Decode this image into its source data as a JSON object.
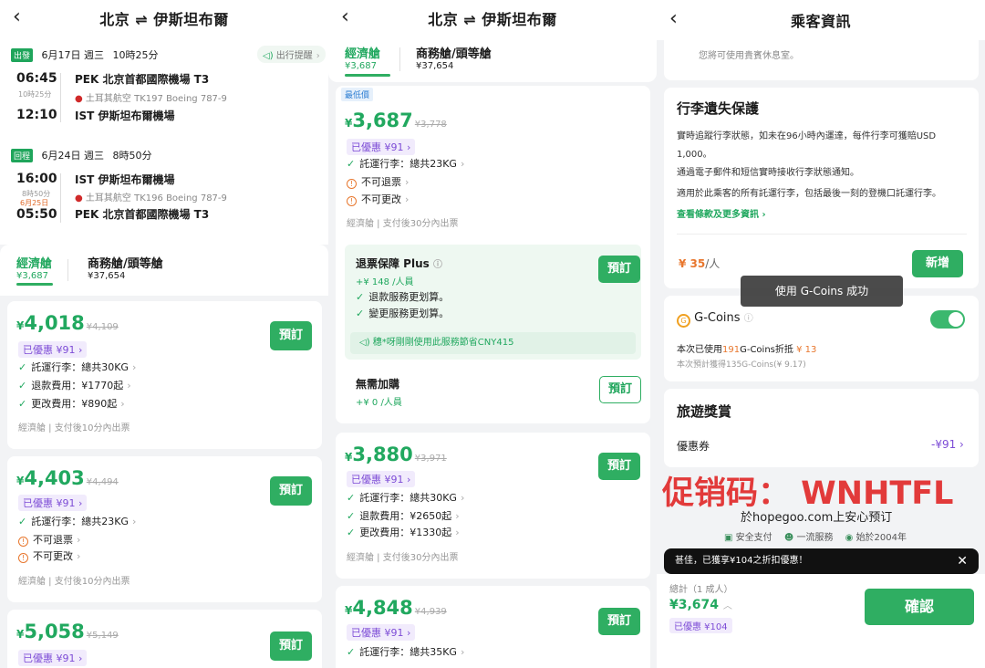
{
  "screen1": {
    "title_from": "北京",
    "title_swap": "⇌",
    "title_to": "伊斯坦布爾",
    "remind": "出行提醒",
    "outbound": {
      "tag": "出發",
      "date": "6月17日 週三",
      "duration": "10時25分",
      "dep_time": "06:45",
      "flight_dur": "10時25分",
      "arr_time": "12:10",
      "dep_airport": "PEK 北京首都國際機場 T3",
      "airline": "土耳其航空",
      "flight_no": "TK197",
      "aircraft": "Boeing 787-9",
      "arr_airport": "IST 伊斯坦布爾機場"
    },
    "inbound": {
      "tag": "回程",
      "date": "6月24日 週三",
      "duration": "8時50分",
      "dep_time": "16:00",
      "flight_dur": "8時50分",
      "next_day": "6月25日",
      "arr_time": "05:50",
      "dep_airport": "IST 伊斯坦布爾機場",
      "airline": "土耳其航空",
      "flight_no": "TK196",
      "aircraft": "Boeing 787-9",
      "arr_airport": "PEK 北京首都國際機場 T3"
    },
    "tabs": [
      {
        "label": "經濟艙",
        "price": "¥3,687"
      },
      {
        "label": "商務艙/頭等艙",
        "price": "¥37,654"
      }
    ],
    "fares": [
      {
        "yen": "¥",
        "price": "4,018",
        "orig": "¥4,109",
        "discount": "已優惠 ¥91 ›",
        "f1": "託運行李：總共30KG",
        "f2": "退款費用：¥1770起",
        "f3": "更改費用：¥890起",
        "note": "經濟艙 | 支付後10分內出票",
        "btn": "預訂"
      },
      {
        "yen": "¥",
        "price": "4,403",
        "orig": "¥4,494",
        "discount": "已優惠 ¥91 ›",
        "f1": "託運行李：總共23KG",
        "f2": "不可退票",
        "f3": "不可更改",
        "note": "經濟艙 | 支付後10分內出票",
        "btn": "預訂"
      },
      {
        "yen": "¥",
        "price": "5,058",
        "orig": "¥5,149",
        "discount": "已優惠 ¥91 ›",
        "btn": "預訂"
      }
    ]
  },
  "screen2": {
    "title_from": "北京",
    "title_swap": "⇌",
    "title_to": "伊斯坦布爾",
    "tabs": [
      {
        "label": "經濟艙",
        "price": "¥3,687"
      },
      {
        "label": "商務艙/頭等艙",
        "price": "¥37,654"
      }
    ],
    "lowest": "最低價",
    "fare1": {
      "yen": "¥",
      "price": "3,687",
      "orig": "¥3,778",
      "discount": "已優惠 ¥91 ›",
      "f1": "託運行李：總共23KG",
      "f2": "不可退票",
      "f3": "不可更改",
      "note": "經濟艙 | 支付後30分內出票"
    },
    "plus": {
      "title": "退票保障 Plus",
      "price": "+¥ 148 /人員",
      "b1": "退款服務更划算。",
      "b2": "變更服務更划算。",
      "btn": "預訂",
      "tip": "穗*呀剛剛使用此服務節省CNY415"
    },
    "noadd": {
      "title": "無需加購",
      "price": "+¥ 0 /人員",
      "btn": "預訂"
    },
    "fare2": {
      "yen": "¥",
      "price": "3,880",
      "orig": "¥3,971",
      "discount": "已優惠 ¥91 ›",
      "f1": "託運行李：總共30KG",
      "f2": "退款費用：¥2650起",
      "f3": "更改費用：¥1330起",
      "note": "經濟艙 | 支付後30分內出票",
      "btn": "預訂"
    },
    "fare3": {
      "yen": "¥",
      "price": "4,848",
      "orig": "¥4,939",
      "discount": "已優惠 ¥91 ›",
      "f1": "託運行李：總共35KG",
      "btn": "預訂"
    }
  },
  "screen3": {
    "title": "乘客資訊",
    "lounge": "您將可使用貴賓休息室。",
    "baggage": {
      "title": "行李遺失保護",
      "p1": "實時追蹤行李狀態，如未在96小時內運達，每件行李可獲賠USD 1,000。",
      "p2": "通過電子郵件和短信實時接收行李狀態通知。",
      "p3": "適用於此乘客的所有託運行李，包括最後一刻的登機口託運行李。",
      "link": "查看條款及更多資訊 ›",
      "price": "¥ 35",
      "unit": "/人",
      "btn": "新增"
    },
    "toast": "使用 G-Coins 成功",
    "gcoins": {
      "label": "G-Coins",
      "used_pre": "本次已使用",
      "used_num": "191",
      "used_mid": "G-Coins折抵",
      "used_amt": "¥ 13",
      "earn": "本次預計獲得135G-Coins(¥ 9.17)"
    },
    "rewards": {
      "title": "旅遊獎賞",
      "coupon": "優惠券",
      "coupon_val": "-¥91 ›"
    },
    "promo": "促销码：  WNHTFL",
    "promo_sub": "於hopegoo.com上安心预订",
    "trust": [
      "安全支付",
      "一流服務",
      "始於2004年"
    ],
    "notice": "甚佳，已獲享¥104之折扣優惠！",
    "total_label": "總計（1 成人）",
    "total": "¥3,674",
    "total_discount": "已優惠 ¥104",
    "confirm": "確認",
    "colors": {
      "accent": "#2fae62",
      "promo": "#e23a3a",
      "coupon": "#7d4cd6"
    }
  }
}
